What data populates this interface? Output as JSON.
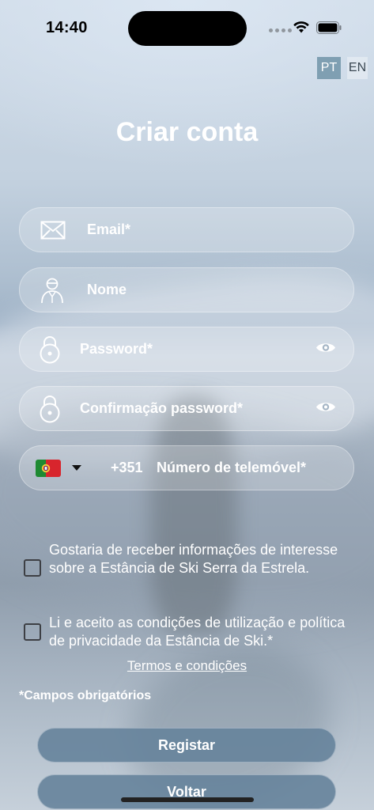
{
  "status_bar": {
    "time": "14:40"
  },
  "language": {
    "options": [
      "PT",
      "EN"
    ],
    "active": "PT"
  },
  "page_title": "Criar conta",
  "fields": {
    "email": "Email*",
    "name": "Nome",
    "password": "Password*",
    "password_confirm": "Confirmação password*",
    "phone_prefix": "+351",
    "phone": "Número de telemóvel*"
  },
  "checkboxes": {
    "newsletter": "Gostaria de receber informações de interesse sobre a Estância de Ski Serra da Estrela.",
    "terms": "Li e aceito as condições de utilização e política de privacidade da Estância de Ski.*"
  },
  "terms_link": "Termos e condições",
  "required_note": "*Campos obrigatórios",
  "buttons": {
    "register": "Registar",
    "back": "Voltar"
  },
  "colors": {
    "button": "#66839b",
    "active_lang": "#7f9fb2"
  },
  "icons": [
    "envelope-icon",
    "person-icon",
    "padlock-icon",
    "eye-icon",
    "portugal-flag-icon",
    "caret-down-icon",
    "wifi-icon",
    "battery-icon"
  ]
}
